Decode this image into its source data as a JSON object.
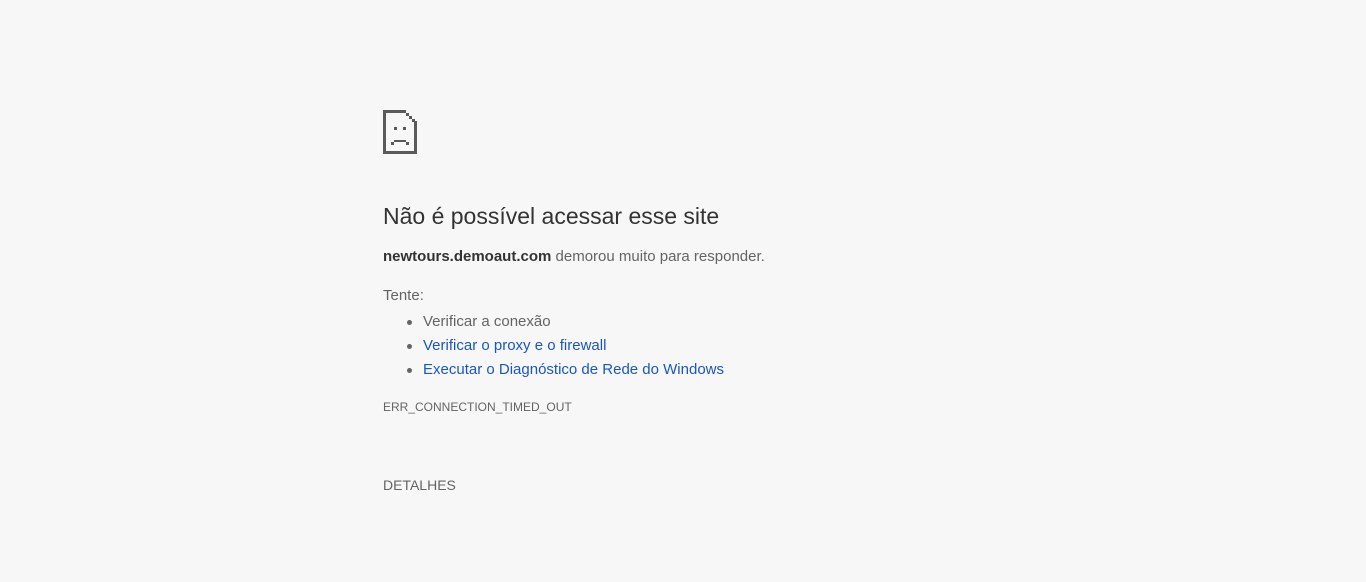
{
  "error_page": {
    "icon": "sad-page-icon",
    "title": "Não é possível acessar esse site",
    "host": "newtours.demoaut.com",
    "host_suffix": " demorou muito para responder.",
    "try_label": "Tente:",
    "suggestions": [
      "Verificar a conexão",
      "Verificar o proxy e o firewall",
      "Executar o Diagnóstico de Rede do Windows"
    ],
    "error_code": "ERR_CONNECTION_TIMED_OUT",
    "details_button": "DETALHES"
  },
  "colors": {
    "background": "#f7f7f7",
    "text": "#646464",
    "heading": "#333333",
    "link": "#1a56c2"
  }
}
